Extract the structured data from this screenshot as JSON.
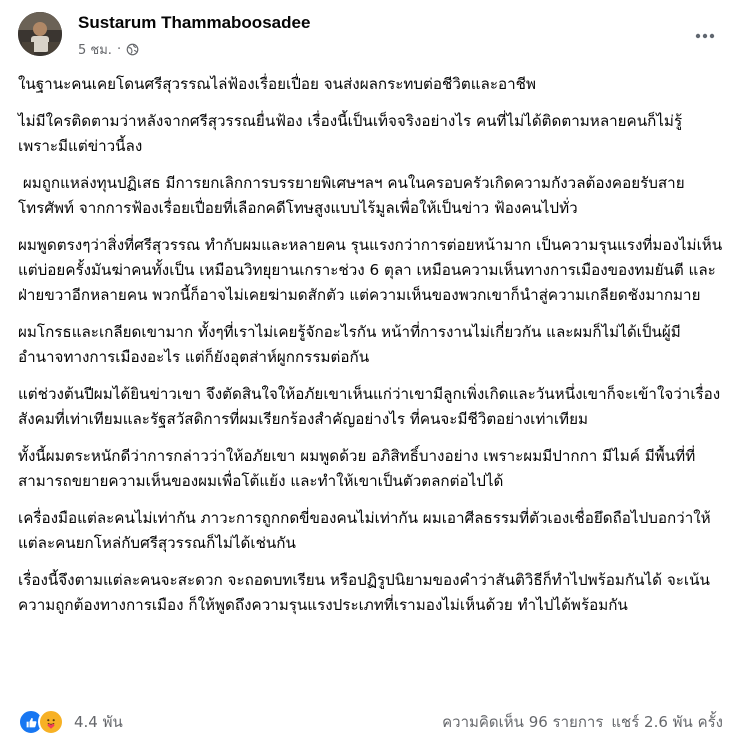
{
  "post": {
    "author_name": "Sustarum Thammaboosadee",
    "timestamp": "5 ชม.",
    "meta_separator": "·",
    "privacy_icon": "globe-icon",
    "more_icon": "more-options-icon",
    "paragraphs": [
      "ในฐานะคนเคยโดนศรีสุวรรณไล่ฟ้องเรื่อยเปื่อย จนส่งผลกระทบต่อชีวิตและอาชีพ",
      "ไม่มีใครติดตามว่าหลังจากศรีสุวรรณยื่นฟ้อง เรื่องนี้เป็นเท็จจริงอย่างไร คนที่ไม่ได้ติดตามหลายคนก็ไม่รู้ เพราะมีแต่ข่าวนี้ลง",
      " ผมถูกแหล่งทุนปฏิเสธ มีการยกเลิกการบรรยายพิเศษฯลฯ คนในครอบครัวเกิดความกังวลต้องคอยรับสายโทรศัพท์ จากการฟ้องเรื่อยเปื่อยที่เลือกคดีโทษสูงแบบไร้มูลเพื่อให้เป็นข่าว ฟ้องคนไปทั่ว",
      "ผมพูดตรงๆว่าสิ่งที่ศรีสุวรรณ ทำกับผมและหลายคน รุนแรงกว่าการต่อยหน้ามาก เป็นความรุนแรงที่มองไม่เห็น แต่บ่อยครั้งมันฆ่าคนทั้งเป็น เหมือนวิทยุยานเกราะช่วง 6 ตุลา เหมือนความเห็นทางการเมืองของทมยันตี และฝ่ายขวาอีกหลายคน พวกนี้ก็อาจไม่เคยฆ่ามดสักตัว แต่ความเห็นของพวกเขาก็นำสู่ความเกลียดชังมากมาย",
      "ผมโกรธและเกลียดเขามาก ทั้งๆที่เราไม่เคยรู้จักอะไรกัน หน้าที่การงานไม่เกี่ยวกัน และผมก็ไม่ได้เป็นผู้มีอำนาจทางการเมืองอะไร แต่ก็ยังอุตส่าห์ผูกกรรมต่อกัน",
      "แต่ช่วงต้นปีผมได้ยินข่าวเขา จึงตัดสินใจให้อภัยเขาเห็นแก่ว่าเขามีลูกเพิ่งเกิดและวันหนึ่งเขาก็จะเข้าใจว่าเรื่องสังคมที่เท่าเทียมและรัฐสวัสดิการที่ผมเรียกร้องสำคัญอย่างไร ที่คนจะมีชีวิตอย่างเท่าเทียม",
      "ทั้งนี้ผมตระหนักดีว่าการกล่าวว่าให้อภัยเขา ผมพูดด้วย อภิสิทธิ์บางอย่าง เพราะผมมีปากกา มีไมค์ มีพื้นที่ที่สามารถขยายความเห็นของผมเพื่อโต้แย้ง และทำให้เขาเป็นตัวตลกต่อไปได้",
      "เครื่องมือแต่ละคนไม่เท่ากัน ภาวะการถูกกดขี่ของคนไม่เท่ากัน ผมเอาศีลธรรมที่ตัวเองเชื่อยึดถือไปบอกว่าให้แต่ละคนยกโหล่กับศรีสุวรรณก็ไม่ได้เช่นกัน",
      "เรื่องนี้จึงตามแต่ละคนจะสะดวก จะถอดบทเรียน หรือปฏิรูปนิยามของคำว่าสันติวิธีก็ทำไปพร้อมกันได้ จะเน้นความถูกต้องทางการเมือง ก็ให้พูดถึงความรุนแรงประเภทที่เรามองไม่เห็นด้วย ทำไปได้พร้อมกัน"
    ]
  },
  "footer": {
    "reaction_icons": [
      "like-icon",
      "care-icon"
    ],
    "reaction_count": "4.4 พัน",
    "comments": "ความคิดเห็น 96 รายการ",
    "shares": "แชร์ 2.6 พัน ครั้ง"
  },
  "colors": {
    "text_primary": "#050505",
    "text_secondary": "#65676b",
    "like_blue": "#1877f2",
    "care_yellow": "#f7b125"
  }
}
